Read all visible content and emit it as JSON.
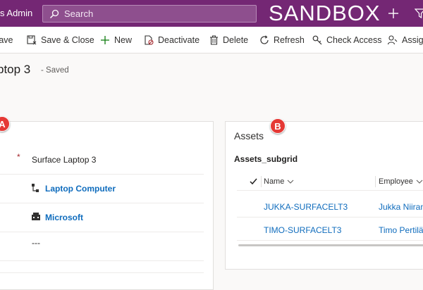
{
  "topbar": {
    "app_name": "s Admin",
    "search_placeholder": "Search",
    "environment": "SANDBOX",
    "icons": [
      "search-icon",
      "plus-icon",
      "filter-icon"
    ]
  },
  "commands": {
    "save": "Save",
    "save_close": "Save & Close",
    "new": "New",
    "deactivate": "Deactivate",
    "delete": "Delete",
    "refresh": "Refresh",
    "check_access": "Check Access",
    "assign": "Assign"
  },
  "record": {
    "title": "ptop 3",
    "status": "- Saved"
  },
  "sections": {
    "left_badge": "A",
    "right_badge": "B"
  },
  "fields": {
    "name_value": "Surface Laptop 3",
    "required_marker": "*",
    "category": "Laptop Computer",
    "manufacturer": "Microsoft",
    "empty_value": "---"
  },
  "assets": {
    "title": "Assets",
    "subgrid_name": "Assets_subgrid",
    "columns": [
      "Name",
      "Employee"
    ],
    "rows": [
      {
        "name": "JUKKA-SURFACELT3",
        "employee": "Jukka Niiranen"
      },
      {
        "name": "TIMO-SURFACELT3",
        "employee": "Timo Pertilä"
      }
    ]
  },
  "colors": {
    "topbar": "#742774",
    "link": "#0f6cbd",
    "badge": "#e53935"
  }
}
